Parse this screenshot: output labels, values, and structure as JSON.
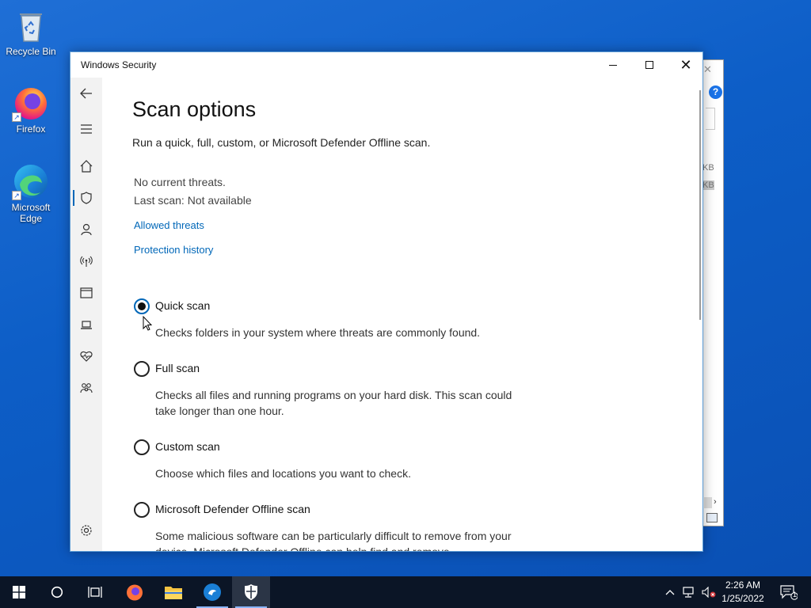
{
  "desktop": {
    "icons": [
      {
        "name": "recycle-bin",
        "label": "Recycle Bin"
      },
      {
        "name": "firefox",
        "label": "Firefox"
      },
      {
        "name": "microsoft-edge",
        "label": "Microsoft Edge"
      }
    ]
  },
  "window": {
    "title": "Windows Security",
    "page_title": "Scan options",
    "subtitle": "Run a quick, full, custom, or Microsoft Defender Offline scan.",
    "status_threats": "No current threats.",
    "status_last_scan": "Last scan: Not available",
    "links": {
      "allowed_threats": "Allowed threats",
      "protection_history": "Protection history"
    },
    "options": [
      {
        "label": "Quick scan",
        "desc": "Checks folders in your system where threats are commonly found.",
        "checked": true
      },
      {
        "label": "Full scan",
        "desc": "Checks all files and running programs on your hard disk. This scan could take longer than one hour.",
        "checked": false
      },
      {
        "label": "Custom scan",
        "desc": "Choose which files and locations you want to check.",
        "checked": false
      },
      {
        "label": "Microsoft Defender Offline scan",
        "desc": "Some malicious software can be particularly difficult to remove from your device. Microsoft Defender Offline can help find and remove",
        "checked": false
      }
    ],
    "sidebar_icons": [
      "back-arrow-icon",
      "hamburger-menu-icon",
      "home-icon",
      "shield-icon",
      "person-icon",
      "wireless-icon",
      "browser-window-icon",
      "laptop-icon",
      "heart-pulse-icon",
      "family-icon",
      "gear-icon"
    ]
  },
  "background_window": {
    "kb1": "KB",
    "kb2": "KB"
  },
  "taskbar": {
    "time": "2:26 AM",
    "date": "1/25/2022",
    "notification_count": "1"
  },
  "colors": {
    "accent": "#0067b8",
    "desktop": "#0d5ec7",
    "taskbar": "#0b1526"
  }
}
